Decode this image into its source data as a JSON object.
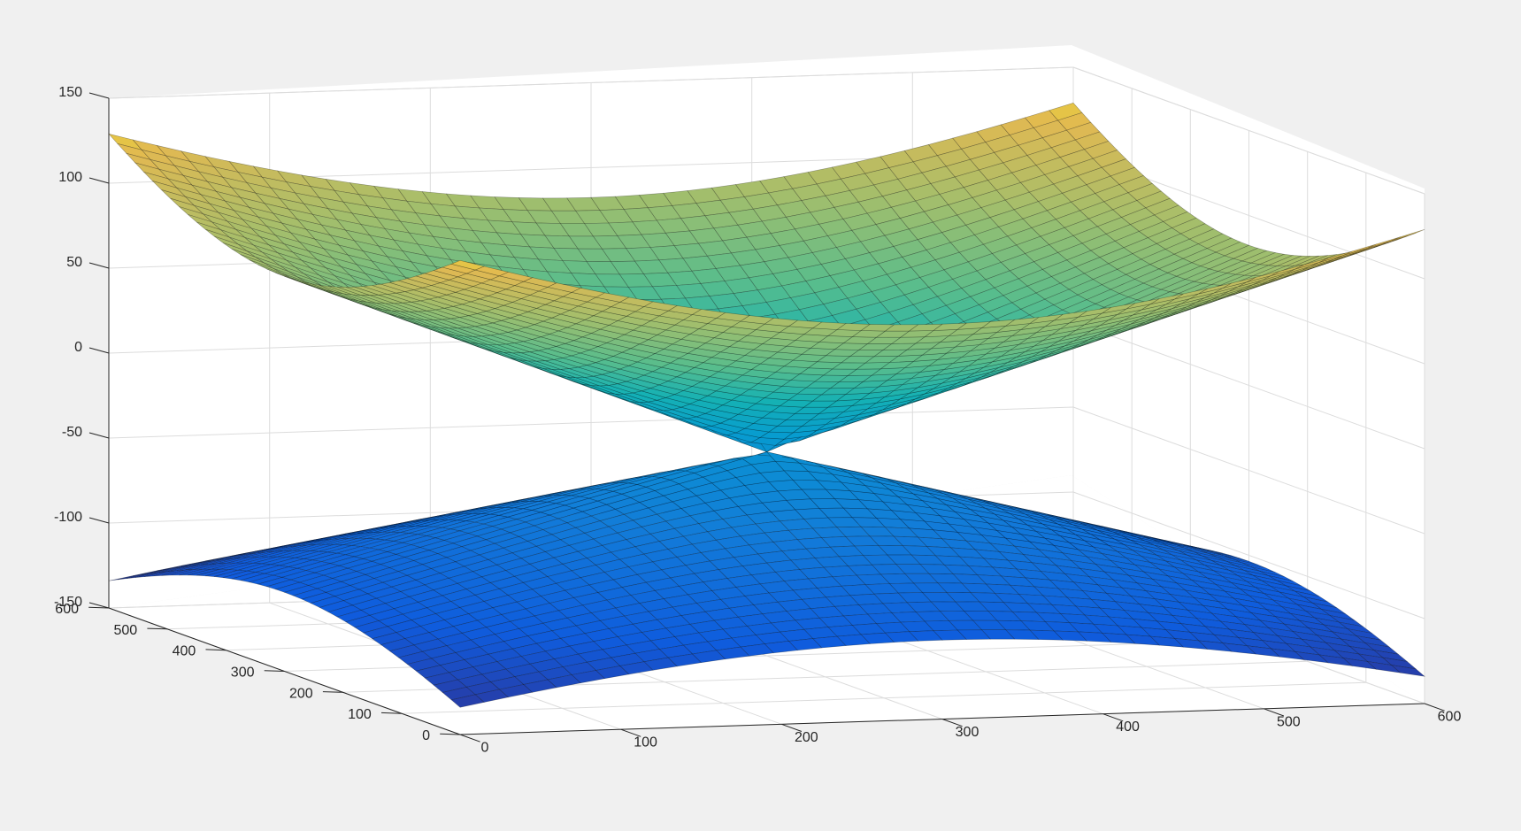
{
  "chart_data": {
    "type": "surface",
    "title": "",
    "xlabel": "",
    "ylabel": "",
    "zlabel": "",
    "x_range": [
      0,
      600
    ],
    "y_range": [
      0,
      600
    ],
    "z_range": [
      -150,
      150
    ],
    "x_ticks": [
      "0",
      "100",
      "200",
      "300",
      "400",
      "500",
      "600"
    ],
    "y_ticks": [
      "0",
      "100",
      "200",
      "300",
      "400",
      "500",
      "600"
    ],
    "z_ticks": [
      "-150",
      "-100",
      "-50",
      "0",
      "50",
      "100",
      "150"
    ],
    "grid": true,
    "box": true,
    "colormap": "parula",
    "series": [
      {
        "surface": "upper cone",
        "x": [
          0,
          100,
          200,
          300,
          400,
          500,
          600
        ],
        "y": [
          0,
          100,
          200,
          300,
          400,
          500,
          600
        ],
        "z_at_corners": {
          "x0_y0": 129,
          "x600_y0": 129,
          "x0_y600": 129,
          "x600_y600": 129
        },
        "z_at_center": -30
      },
      {
        "surface": "lower cone",
        "x": [
          0,
          100,
          200,
          300,
          400,
          500,
          600
        ],
        "y": [
          0,
          100,
          200,
          300,
          400,
          500,
          600
        ],
        "z_at_corners": {
          "x0_y0": -134,
          "x600_y0": -134,
          "x0_y600": -134,
          "x600_y600": -134
        },
        "z_at_center": -30
      }
    ],
    "colors": {
      "background": "#f0f0f0",
      "axes_face": "#ffffff",
      "grid": "#dcdcdc",
      "axis_line": "#262626",
      "mesh_edge": "#000000"
    }
  }
}
